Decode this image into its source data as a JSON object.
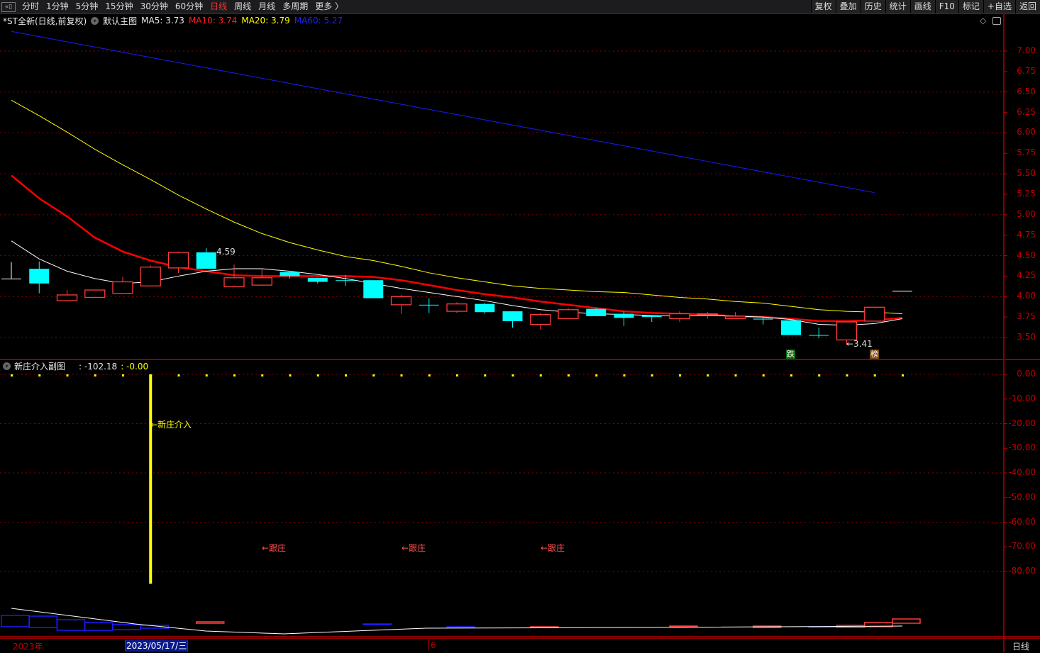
{
  "toolbar": {
    "tabs": [
      "分时",
      "1分钟",
      "5分钟",
      "15分钟",
      "30分钟",
      "60分钟",
      "日线",
      "周线",
      "月线",
      "多周期",
      "更多 〉"
    ],
    "active_tab": "日线",
    "buttons": [
      "复权",
      "叠加",
      "历史",
      "统计",
      "画线",
      "F10",
      "标记",
      "+自选",
      "返回"
    ]
  },
  "header": {
    "title": "*ST全新(日线,前复权)",
    "main_chart": "默认主图",
    "ma5": "MA5: 3.73",
    "ma10": "MA10: 3.74",
    "ma20": "MA20: 3.79",
    "ma60": "MA60: 5.27"
  },
  "sub": {
    "title": "新庄介入副图",
    "value1": ": -102.18",
    "value2": ": -0.00",
    "label_entry": "←新庄介入",
    "label_follow": "←跟庄"
  },
  "annotations": {
    "high": "4.59",
    "low": "←3.41",
    "tag_fall": "跌",
    "tag_list": "榜"
  },
  "timeaxis": {
    "year": "2023年",
    "cursor_date": "2023/05/17/三",
    "month": "6",
    "period": "日线"
  },
  "colors": {
    "up": "#ff3b3b",
    "down": "#00ffff",
    "ma5": "#ffffff",
    "ma10": "#ff0000",
    "ma20": "#ffff00",
    "ma60": "#1a1aff",
    "axis": "#c00000"
  },
  "chart_data": {
    "type": "candlestick",
    "price_ticks": [
      "7.00",
      "6.75",
      "6.50",
      "6.25",
      "6.00",
      "5.75",
      "5.50",
      "5.25",
      "5.00",
      "4.75",
      "4.50",
      "4.25",
      "4.00",
      "3.75",
      "3.50"
    ],
    "ylim": [
      3.35,
      7.24
    ],
    "sub_ticks": [
      "0.00",
      "-10.00",
      "-20.00",
      "-30.00",
      "-40.00",
      "-50.00",
      "-60.00",
      "-70.00",
      "-80.00"
    ],
    "candles": [
      [
        4.22,
        4.22,
        4.42,
        4.22
      ],
      [
        4.34,
        4.16,
        4.43,
        4.04
      ],
      [
        3.95,
        4.02,
        4.08,
        3.95
      ],
      [
        3.99,
        4.08,
        4.08,
        3.99
      ],
      [
        4.04,
        4.18,
        4.24,
        4.04
      ],
      [
        4.13,
        4.36,
        4.38,
        4.13
      ],
      [
        4.35,
        4.54,
        4.55,
        4.29
      ],
      [
        4.54,
        4.34,
        4.59,
        4.34
      ],
      [
        4.12,
        4.23,
        4.39,
        4.12
      ],
      [
        4.14,
        4.23,
        4.33,
        4.13
      ],
      [
        4.3,
        4.25,
        4.3,
        4.22
      ],
      [
        4.23,
        4.18,
        4.23,
        4.16
      ],
      [
        4.2,
        4.2,
        4.26,
        4.13
      ],
      [
        4.2,
        3.98,
        4.2,
        3.98
      ],
      [
        3.9,
        4.0,
        4.02,
        3.79
      ],
      [
        3.9,
        3.9,
        3.98,
        3.8
      ],
      [
        3.82,
        3.91,
        3.93,
        3.8
      ],
      [
        3.91,
        3.81,
        3.92,
        3.79
      ],
      [
        3.82,
        3.7,
        3.82,
        3.62
      ],
      [
        3.66,
        3.78,
        3.8,
        3.6
      ],
      [
        3.73,
        3.84,
        3.86,
        3.73
      ],
      [
        3.85,
        3.76,
        3.86,
        3.76
      ],
      [
        3.79,
        3.74,
        3.82,
        3.64
      ],
      [
        3.77,
        3.75,
        3.77,
        3.69
      ],
      [
        3.73,
        3.79,
        3.82,
        3.69
      ],
      [
        3.78,
        3.79,
        3.81,
        3.73
      ],
      [
        3.73,
        3.76,
        3.81,
        3.73
      ],
      [
        3.73,
        3.72,
        3.74,
        3.66
      ],
      [
        3.71,
        3.53,
        3.72,
        3.53
      ],
      [
        3.53,
        3.53,
        3.62,
        3.49
      ],
      [
        3.47,
        3.69,
        3.69,
        3.41
      ],
      [
        3.7,
        3.87,
        3.87,
        3.7
      ],
      [
        4.07,
        4.07,
        4.07,
        4.07
      ]
    ],
    "ma5": [
      4.68,
      4.46,
      4.31,
      4.22,
      4.16,
      4.18,
      4.25,
      4.31,
      4.34,
      4.34,
      4.31,
      4.27,
      4.22,
      4.16,
      4.1,
      4.05,
      4.0,
      3.95,
      3.89,
      3.84,
      3.81,
      3.79,
      3.78,
      3.77,
      3.76,
      3.77,
      3.76,
      3.75,
      3.72,
      3.66,
      3.65,
      3.67,
      3.73
    ],
    "ma10": [
      5.48,
      5.2,
      4.98,
      4.72,
      4.55,
      4.44,
      4.36,
      4.31,
      4.26,
      4.25,
      4.25,
      4.25,
      4.25,
      4.24,
      4.2,
      4.14,
      4.08,
      4.03,
      3.99,
      3.94,
      3.9,
      3.86,
      3.82,
      3.8,
      3.79,
      3.78,
      3.76,
      3.75,
      3.73,
      3.7,
      3.7,
      3.71,
      3.74
    ],
    "ma20": [
      6.4,
      6.21,
      6.01,
      5.8,
      5.61,
      5.43,
      5.24,
      5.07,
      4.91,
      4.77,
      4.66,
      4.57,
      4.49,
      4.44,
      4.37,
      4.29,
      4.23,
      4.18,
      4.13,
      4.1,
      4.08,
      4.06,
      4.05,
      4.02,
      3.99,
      3.97,
      3.94,
      3.92,
      3.88,
      3.84,
      3.82,
      3.81,
      3.79
    ],
    "ma60": [
      7.24,
      5.27
    ],
    "entry_signal": {
      "bar": 5,
      "value": -85
    },
    "follow_signals": [
      9,
      14,
      19
    ]
  }
}
